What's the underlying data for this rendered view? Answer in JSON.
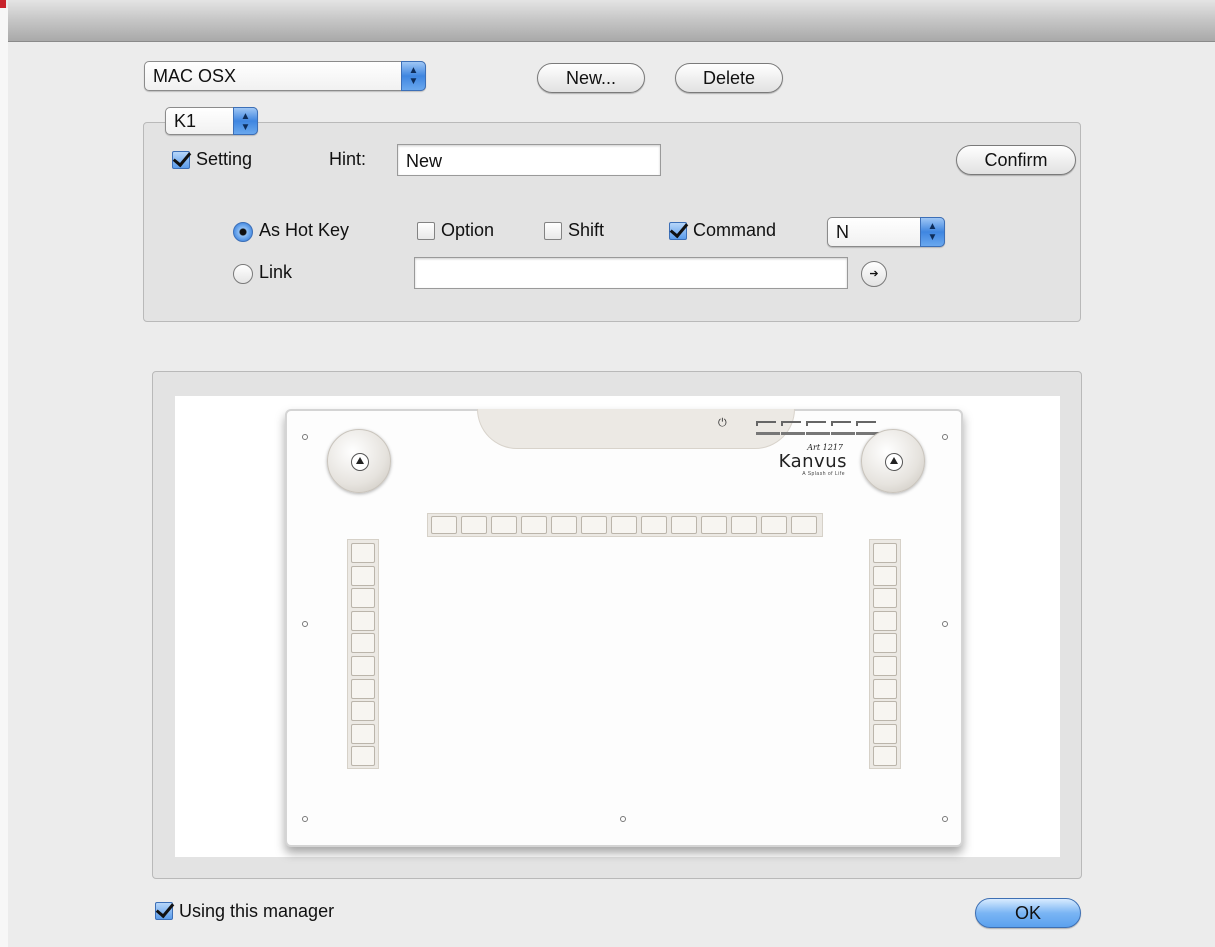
{
  "window": {
    "title": ""
  },
  "profile": {
    "selected": "MAC OSX",
    "new_label": "New...",
    "delete_label": "Delete"
  },
  "key_group": {
    "selected_key": "K1",
    "setting_label": "Setting",
    "setting_checked": true,
    "hint_label": "Hint:",
    "hint_value": "New",
    "confirm_label": "Confirm",
    "mode": "As Hot Key",
    "hotkey_label": "As Hot Key",
    "link_label": "Link",
    "option_label": "Option",
    "option_checked": false,
    "shift_label": "Shift",
    "shift_checked": false,
    "command_label": "Command",
    "command_checked": true,
    "key_value": "N",
    "link_value": "",
    "go_icon": "arrow-right-icon"
  },
  "tablet": {
    "brand": "Kanvus",
    "brand_script": "Art 1217",
    "brand_tagline": "A Splash of Life",
    "top_key_count": 13,
    "side_key_count": 10
  },
  "footer": {
    "using_label": "Using this manager",
    "using_checked": true,
    "ok_label": "OK"
  },
  "colors": {
    "accent": "#3f86e0",
    "background": "#ececec",
    "panel": "#e3e3e3"
  }
}
